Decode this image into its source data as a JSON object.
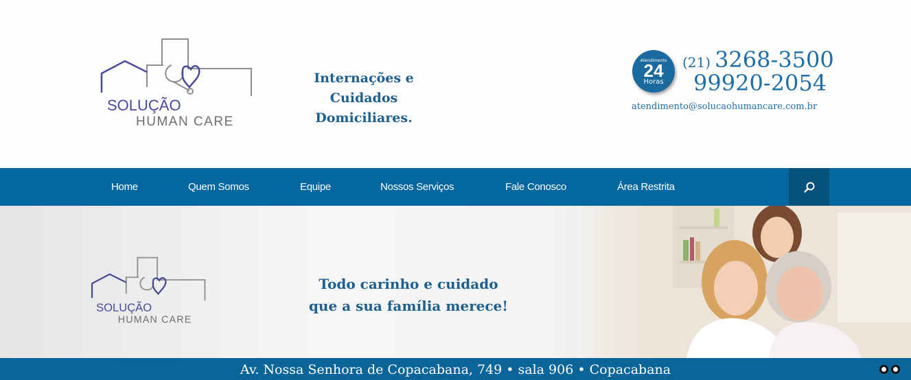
{
  "header": {
    "logo": {
      "line1": "SOLUÇÃO",
      "line2": "HUMAN CARE"
    },
    "tagline": [
      "Internações e Cuidados",
      "Domiciliares."
    ],
    "contact": {
      "badge_top": "Atendimento",
      "badge_num": "24",
      "badge_bottom": "Horas",
      "area_code": "(21)",
      "phone1": "3268-3500",
      "phone2": "99920-2054",
      "email": "atendimento@solucaohumancare.com.br"
    }
  },
  "nav": {
    "items": [
      {
        "label": "Home"
      },
      {
        "label": "Quem Somos"
      },
      {
        "label": "Equipe"
      },
      {
        "label": "Nossos Serviços"
      },
      {
        "label": "Fale Conosco"
      },
      {
        "label": "Área Restrita"
      }
    ],
    "search_icon": "search-icon"
  },
  "banner": {
    "logo": {
      "line1": "SOLUÇÃO",
      "line2": "HUMAN CARE"
    },
    "slogan": [
      "Todo carinho e cuidado",
      "que a sua família merece!"
    ],
    "address": "Av. Nossa Senhora de Copacabana, 749 • sala 906 • Copacabana",
    "slide_count": 2
  },
  "colors": {
    "brand_blue": "#04679f",
    "logo_purple": "#4b4a9a",
    "logo_gray": "#8e8e8e",
    "text_blue": "#1d6ea8"
  }
}
